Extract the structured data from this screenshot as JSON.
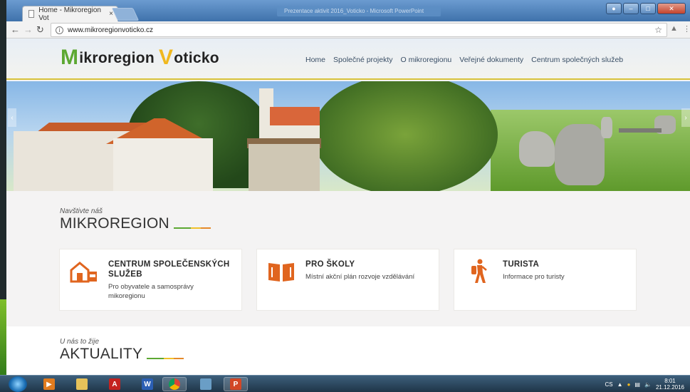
{
  "browser": {
    "tab_title": "Home - Mikroregion Vot",
    "tab_close": "×",
    "url": "www.mikroregionvoticko.cz",
    "window_preview": "Prezentace aktivit 2016_Voticko - Microsoft PowerPoint"
  },
  "site": {
    "logo": {
      "first_letter": "M",
      "first_rest": "ikroregion",
      "second_letter": "V",
      "second_rest": "oticko"
    },
    "nav": [
      "Home",
      "Společné projekty",
      "O mikroregionu",
      "Veřejné dokumenty",
      "Centrum společných služeb"
    ]
  },
  "section1": {
    "kicker": "Navštivte náš",
    "heading": "MIKROREGION"
  },
  "cards": [
    {
      "icon": "house-icon",
      "title": "CENTRUM SPOLEČENSKÝCH SLUŽEB",
      "desc": "Pro obyvatele a samosprávy mikoregionu"
    },
    {
      "icon": "book-icon",
      "title": "PRO ŠKOLY",
      "desc": "Místní akční plán rozvoje vzdělávání"
    },
    {
      "icon": "hiker-icon",
      "title": "TURISTA",
      "desc": "Informace pro turisty"
    }
  ],
  "section2": {
    "kicker": "U nás to žije",
    "heading": "AKTUALITY"
  },
  "colors": {
    "accent_green": "#5ca832",
    "accent_yellow": "#f0c02a",
    "accent_orange": "#e58a2b",
    "icon_orange": "#e0651f"
  },
  "taskbar": {
    "apps": [
      "start-orb",
      "media-player",
      "file-explorer",
      "acrobat",
      "word",
      "chrome",
      "photo",
      "powerpoint"
    ],
    "lang": "CS",
    "time": "8:01",
    "date": "21.12.2016"
  }
}
